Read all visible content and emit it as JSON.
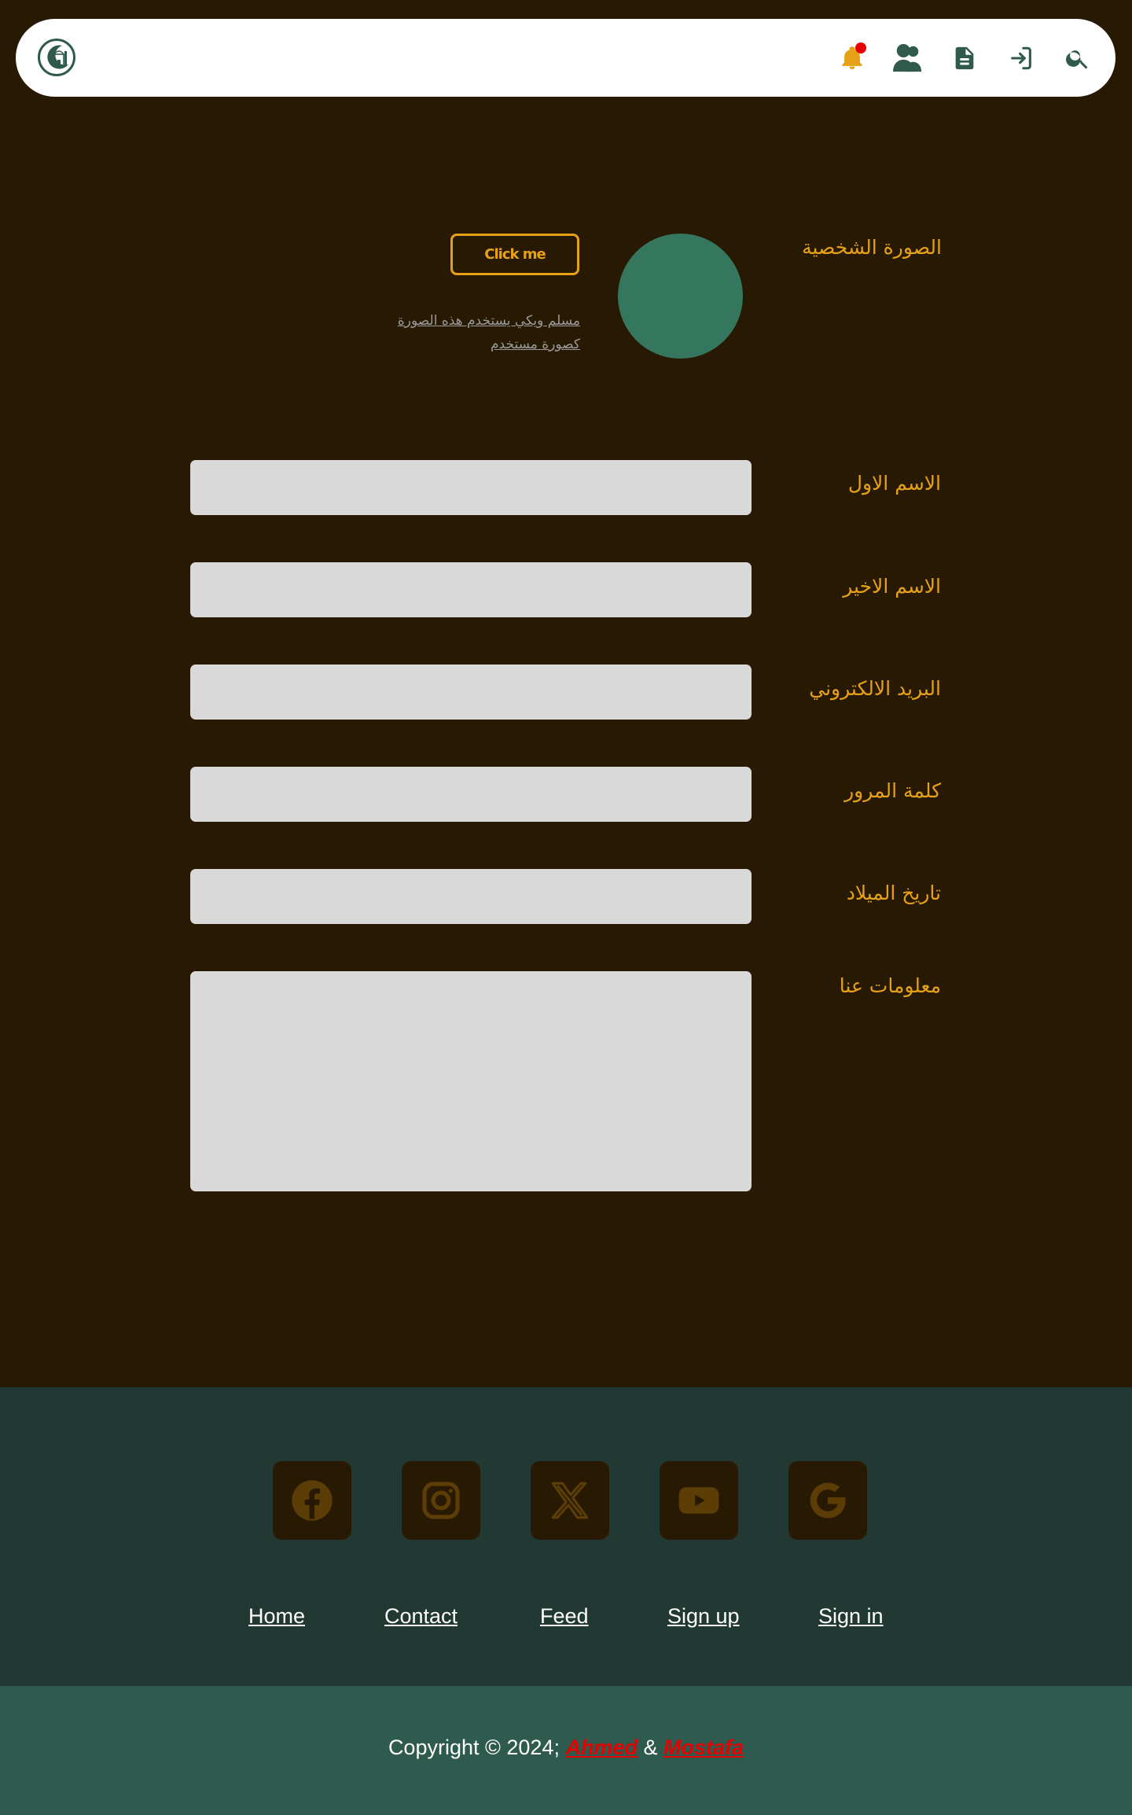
{
  "colors": {
    "background": "#281a02",
    "accent": "#e6a117",
    "icon": "#2f5a4c",
    "input_bg": "#d9d9d9",
    "avatar": "#35775e",
    "footer": "#223832",
    "copyright_bar": "#2f5a4e",
    "author_link": "#e60000"
  },
  "navbar": {
    "logo_icon": "mosque-crescent-logo",
    "icons": [
      "bell-icon",
      "users-icon",
      "document-icon",
      "sign-in-icon",
      "search-icon"
    ],
    "has_notification": true
  },
  "profile": {
    "avatar_label": "الصورة الشخصية",
    "button_label": "Click me",
    "note_line1": "مسلم ويكي يستخدم هذه الصورة",
    "note_line2": "كصورة مستخدم"
  },
  "form": {
    "first_name_label": "الاسم الاول",
    "last_name_label": "الاسم الاخير",
    "email_label": "البريد الالكتروني",
    "password_label": "كلمة المرور",
    "birthdate_label": "تاريخ الميلاد",
    "about_label": "معلومات عنا",
    "first_name_value": "",
    "last_name_value": "",
    "email_value": "",
    "password_value": "",
    "birthdate_value": "",
    "about_value": ""
  },
  "footer": {
    "social_icons": [
      "facebook-icon",
      "instagram-icon",
      "x-icon",
      "youtube-icon",
      "google-icon"
    ],
    "links": {
      "home": "Home",
      "contact": "Contact",
      "feed": "Feed",
      "signup": "Sign up",
      "signin": "Sign in"
    },
    "copyright_prefix": "Copyright © 2024;",
    "author1": "Ahmed",
    "ampersand": "&",
    "author2": "Mostafa"
  }
}
